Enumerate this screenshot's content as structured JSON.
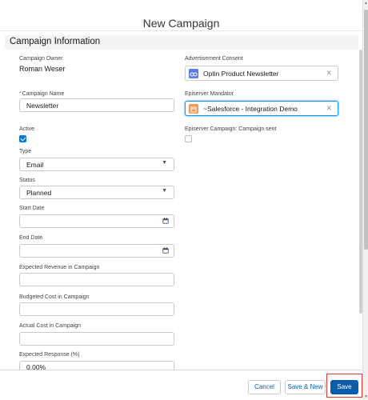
{
  "modal": {
    "title": "New Campaign",
    "section_title": "Campaign Information"
  },
  "fields": {
    "owner": {
      "label": "Campaign Owner",
      "value": "Roman Weser"
    },
    "name": {
      "required": "*",
      "label": "Campaign Name",
      "value": "Newsletter"
    },
    "active": {
      "label": "Active",
      "checked": true
    },
    "type": {
      "label": "Type",
      "value": "Email"
    },
    "status": {
      "label": "Status",
      "value": "Planned"
    },
    "start_date": {
      "label": "Start Date",
      "value": ""
    },
    "end_date": {
      "label": "End Date",
      "value": ""
    },
    "expected_revenue": {
      "label": "Expected Revenue in Campaign",
      "value": ""
    },
    "budgeted_cost": {
      "label": "Budgeted Cost in Campaign",
      "value": ""
    },
    "actual_cost": {
      "label": "Actual Cost in Campaign",
      "value": ""
    },
    "expected_response": {
      "label": "Expected Response (%)",
      "value": "0.00%"
    },
    "ad_consent": {
      "label": "Advertisement Consent",
      "value": "Optin Product Newsletter",
      "icon": "consent-icon",
      "icon_color": "#5a7be0"
    },
    "episerver_mandator": {
      "label": "Episerver Mandator",
      "value": "~Salesforce - Integration Demo",
      "icon": "mandator-icon",
      "icon_color": "#f49756"
    },
    "episerver_campaign_sent": {
      "label": "Episerver Campaign: Campaign sent",
      "checked": false
    }
  },
  "footer": {
    "cancel": "Cancel",
    "save_new": "Save & New",
    "save": "Save"
  },
  "colors": {
    "accent": "#0b5cab",
    "highlight": "#e53935"
  }
}
